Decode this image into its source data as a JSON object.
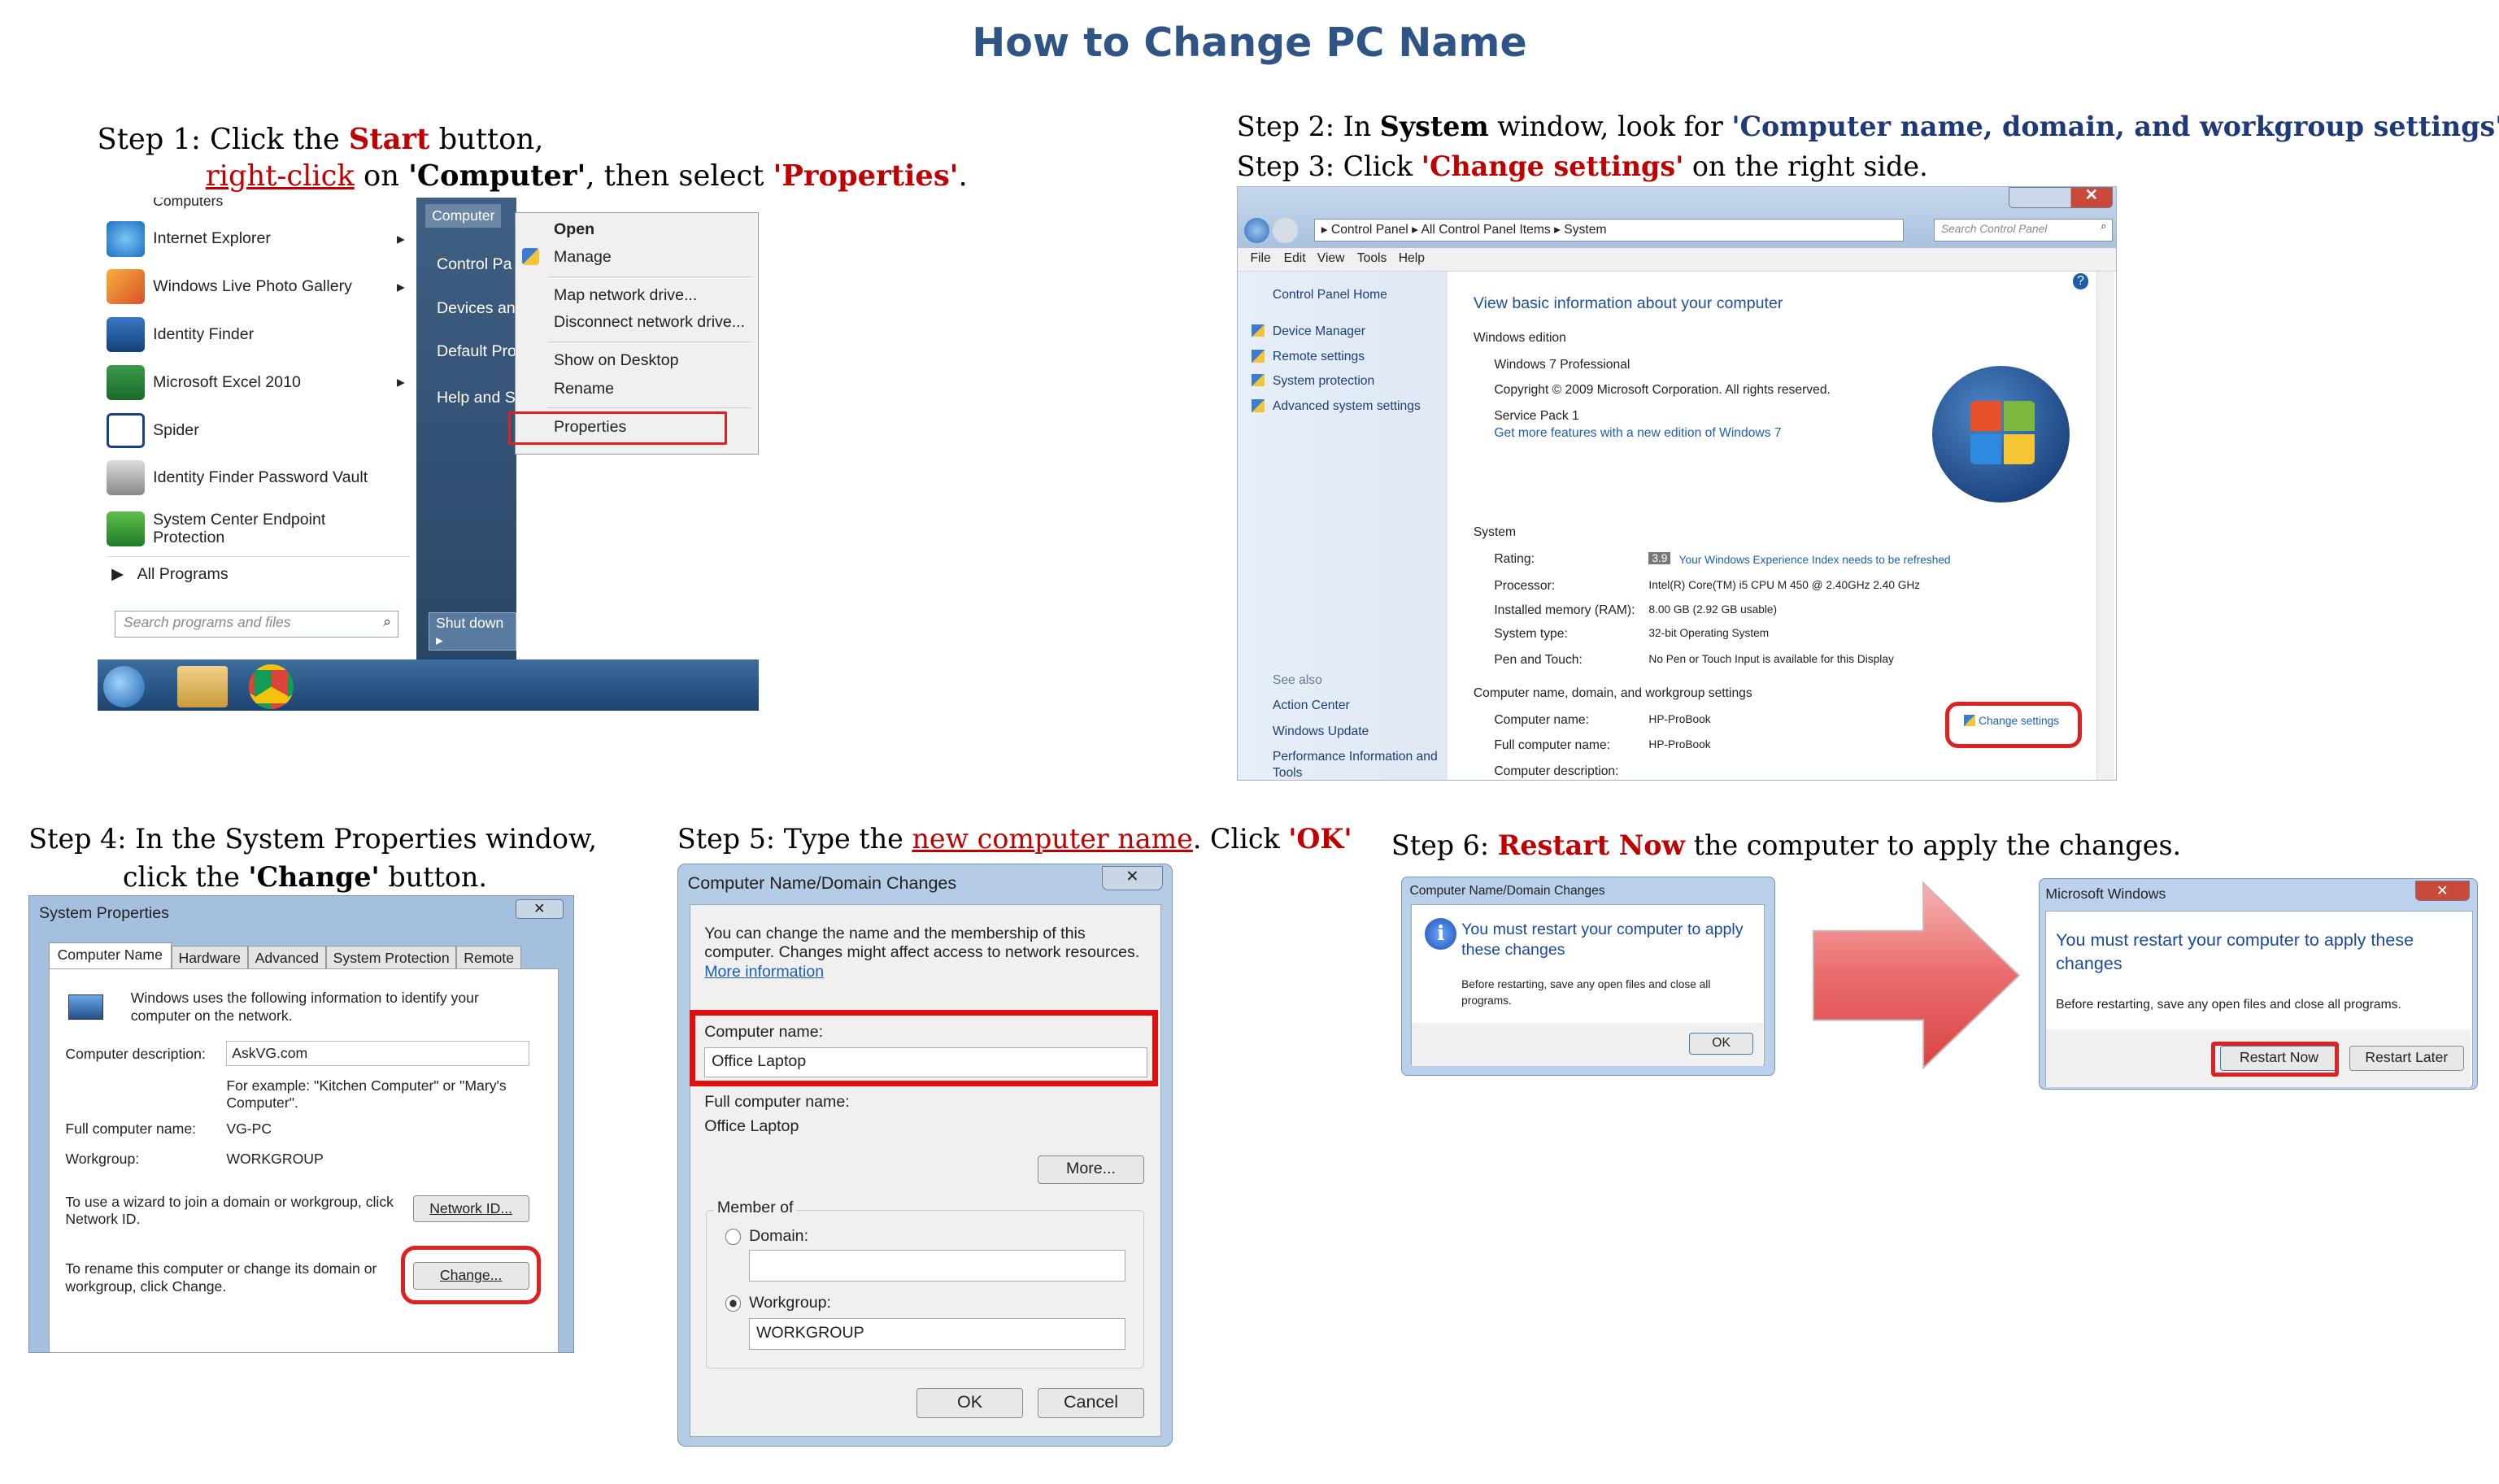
{
  "title": "How to Change PC Name",
  "step1": {
    "line1_pre": "Step 1: Click the ",
    "line1_em": "Start",
    "line1_post": " button,",
    "line2_link": "right-click",
    "line2_mid": " on ",
    "line2_b1": "'Computer'",
    "line2_mid2": ", then select ",
    "line2_b2": "'Properties'",
    "line2_end": ".",
    "menu_items": [
      "Internet Explorer",
      "Windows Live Photo Gallery",
      "Identity Finder",
      "Microsoft Excel 2010",
      "Spider",
      "Identity Finder Password Vault",
      "System Center Endpoint Protection"
    ],
    "top_item": "Computers",
    "all_programs": "All Programs",
    "search_placeholder": "Search programs and files",
    "right_items": [
      "Computer",
      "Control Pa",
      "Devices an",
      "Default Pro",
      "Help and S"
    ],
    "shutdown": "Shut down",
    "context": [
      "Open",
      "Manage",
      "Map network drive...",
      "Disconnect network drive...",
      "Show on Desktop",
      "Rename",
      "Properties"
    ]
  },
  "step2": {
    "line1_pre": "Step 2: In ",
    "line1_b": "System",
    "line1_mid": " window, look for ",
    "line1_q": "'Computer name, domain, and workgroup settings'",
    "line1_end": ".",
    "line2_pre": "Step 3: Click ",
    "line2_q": "'Change settings'",
    "line2_post": " on the right side.",
    "breadcrumb": [
      "Control Panel",
      "All Control Panel Items",
      "System"
    ],
    "search": "Search Control Panel",
    "menu": [
      "File",
      "Edit",
      "View",
      "Tools",
      "Help"
    ],
    "nav_home": "Control Panel Home",
    "nav": [
      "Device Manager",
      "Remote settings",
      "System protection",
      "Advanced system settings"
    ],
    "see_also": "See also",
    "see_also_items": [
      "Action Center",
      "Windows Update",
      "Performance Information and",
      "Tools"
    ],
    "heading": "View basic information about your computer",
    "edition_hdr": "Windows edition",
    "edition": [
      "Windows 7 Professional",
      "Copyright © 2009 Microsoft Corporation.  All rights reserved.",
      "Service Pack 1"
    ],
    "edition_link": "Get more features with a new edition of Windows 7",
    "system_hdr": "System",
    "sys_labels": [
      "Rating:",
      "Processor:",
      "Installed memory (RAM):",
      "System type:",
      "Pen and Touch:"
    ],
    "rating_badge": "3.9",
    "sys_values": [
      "Your Windows Experience Index needs to be refreshed",
      "Intel(R) Core(TM) i5 CPU       M 450  @ 2.40GHz   2.40 GHz",
      "8.00 GB (2.92 GB usable)",
      "32-bit Operating System",
      "No Pen or Touch Input is available for this Display"
    ],
    "cn_hdr": "Computer name, domain, and workgroup settings",
    "cn_labels": [
      "Computer name:",
      "Full computer name:",
      "Computer description:"
    ],
    "cn_values": [
      "HP-ProBook",
      "HP-ProBook",
      ""
    ],
    "change_settings": "Change settings"
  },
  "step4": {
    "line1": "Step 4: In the System Properties window,",
    "line2_pre": "click the ",
    "line2_b": "'Change'",
    "line2_post": " button.",
    "win_title": "System Properties",
    "tabs": [
      "Computer Name",
      "Hardware",
      "Advanced",
      "System Protection",
      "Remote"
    ],
    "intro": "Windows uses the following information to identify your computer on the network.",
    "desc_label": "Computer description:",
    "desc_value": "AskVG.com",
    "example": "For example: \"Kitchen Computer\" or \"Mary's Computer\".",
    "full_label": "Full computer name:",
    "full_value": "VG-PC",
    "wg_label": "Workgroup:",
    "wg_value": "WORKGROUP",
    "wizard_text": "To use a wizard to join a domain or workgroup, click Network ID.",
    "network_btn": "Network ID...",
    "rename_text": "To rename this computer or change its domain or workgroup, click Change.",
    "change_btn": "Change..."
  },
  "step5": {
    "pre": "Step 5: Type the ",
    "link": "new computer name",
    "mid": ". Click ",
    "ok": "'OK'",
    "win_title": "Computer Name/Domain Changes",
    "intro": "You can change the name and the membership of this computer. Changes might affect access to network resources.",
    "more_info": "More information",
    "cn_label": "Computer name:",
    "cn_value": "Office Laptop",
    "full_label": "Full computer name:",
    "full_value": "Office Laptop",
    "more_btn": "More...",
    "member_of": "Member of",
    "domain_label": "Domain:",
    "workgroup_label": "Workgroup:",
    "workgroup_value": "WORKGROUP",
    "ok_btn": "OK",
    "cancel_btn": "Cancel"
  },
  "step6": {
    "pre": "Step 6: ",
    "em": "Restart Now",
    "post": " the computer to apply the changes.",
    "d1_title": "Computer Name/Domain Changes",
    "d1_msg": "You must restart your computer to apply these changes",
    "d1_sub": "Before restarting, save any open files and close all programs.",
    "d1_ok": "OK",
    "d2_title": "Microsoft Windows",
    "d2_msg": "You must restart your computer to apply these changes",
    "d2_sub": "Before restarting, save any open files and close all programs.",
    "restart_now": "Restart Now",
    "restart_later": "Restart Later"
  }
}
